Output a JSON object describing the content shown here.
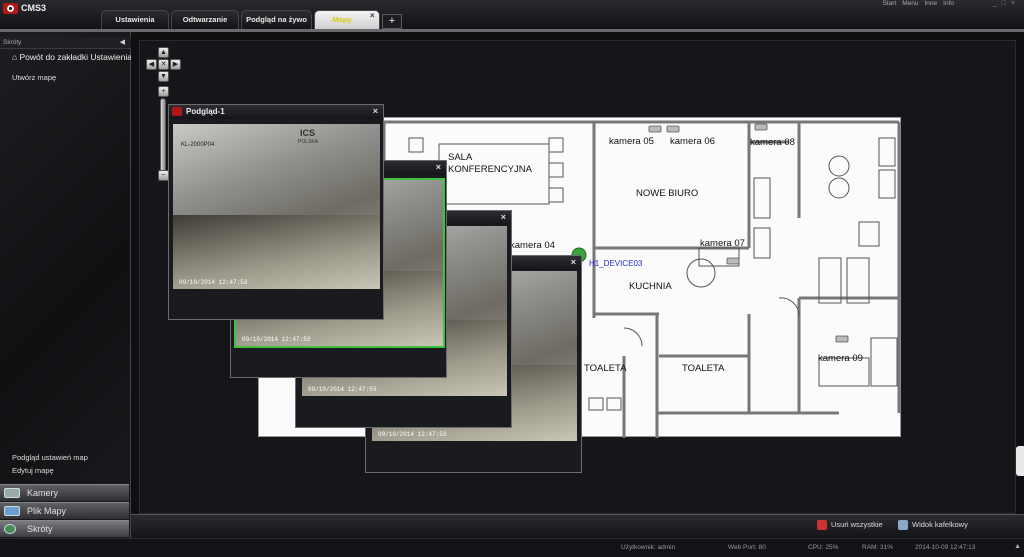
{
  "app": {
    "name": "CMS3"
  },
  "tabs": [
    {
      "label": "Ustawienia"
    },
    {
      "label": "Odtwarzanie"
    },
    {
      "label": "Podgląd na żywo"
    },
    {
      "label": "Mapy"
    }
  ],
  "tab_add": "+",
  "tab_close": "×",
  "top_menu": {
    "start": "Start",
    "menu": "Menu",
    "inne": "Inne",
    "info": "Info"
  },
  "sidebar": {
    "title": "Skróty",
    "home_link": "Powót do zakładki Ustawienia",
    "create_map": "Utwórz mapę",
    "map_settings_preview": "Podgląd ustawień map",
    "edit_map": "Edytuj mapę",
    "nav": [
      {
        "label": "Kamery"
      },
      {
        "label": "Plik Mapy"
      },
      {
        "label": "Skróty"
      }
    ]
  },
  "preview_window": {
    "title": "Podgląd-1",
    "close": "×"
  },
  "video": {
    "timestamp": "09/10/2014 12:47:53",
    "channel": "KL-2000P04",
    "logo_line1": "ICS",
    "logo_line2": "POLSKA"
  },
  "floorplan": {
    "rooms": {
      "sala1": "SALA",
      "sala2": "KONFERENCYJNA",
      "nowe_biuro": "NOWE BIURO",
      "kuchnia": "KUCHNIA",
      "toaleta1": "TOALETA",
      "toaleta2": "TOALETA"
    },
    "cameras": {
      "c04": "kamera 04",
      "c05": "kamera 05",
      "c06": "kamera 06",
      "c07": "kamera 07",
      "c08": "kamera 08",
      "c09": "kamera 09"
    },
    "device": "H1_DEVICE03"
  },
  "bottom": {
    "remove_all": "Usuń wszystkie",
    "tile_view": "Widok kafelkowy"
  },
  "status": {
    "user": "Użytkownik: admin",
    "web_port": "Web Port: 80",
    "cpu": "CPU: 25%",
    "ram": "RAM: 31%",
    "datetime": "2014-10-09 12:47:13"
  },
  "colors": {
    "active_tab_text": "#d7cc15",
    "video_border_active": "#3ec23e",
    "device_dot": "#3aa63a"
  }
}
